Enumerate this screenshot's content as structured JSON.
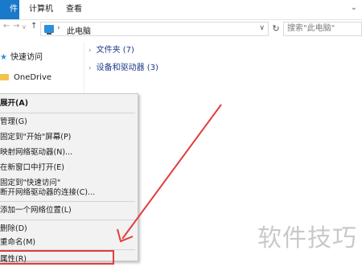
{
  "ribbon": {
    "tabs": [
      "件",
      "计算机",
      "查看"
    ]
  },
  "nav": {
    "back": "←",
    "forward": "→",
    "dropdown": "∨",
    "up": "↑",
    "breadcrumb_arrow": "›",
    "breadcrumb": "此电脑",
    "address_dropdown": "∨",
    "refresh": "↻",
    "search_placeholder": "搜索\"此电脑\""
  },
  "sidebar": {
    "items": [
      {
        "label": "快速访问",
        "icon": "star-icon"
      },
      {
        "label": "OneDrive",
        "icon": "folder-icon"
      }
    ]
  },
  "content": {
    "groups": [
      {
        "label": "文件夹 (7)"
      },
      {
        "label": "设备和驱动器 (3)"
      }
    ]
  },
  "context_menu": {
    "items": [
      "展开(A)",
      "管理(G)",
      "固定到\"开始\"屏幕(P)",
      "映射网络驱动器(N)...",
      "在新窗口中打开(E)",
      "固定到\"快速访问\"",
      "断开网络驱动器的连接(C)...",
      "添加一个网络位置(L)",
      "删除(D)",
      "重命名(M)",
      "属性(R)"
    ]
  },
  "watermark": "软件技巧",
  "colors": {
    "accent": "#1979ca",
    "highlight": "#e33c3c"
  }
}
